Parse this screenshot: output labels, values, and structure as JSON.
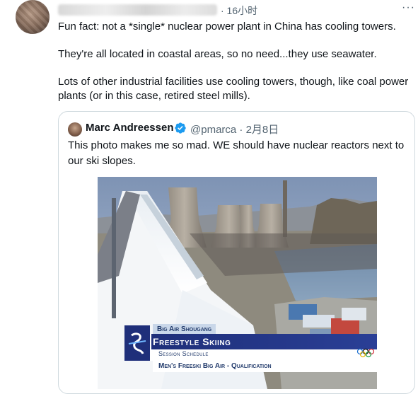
{
  "tweet": {
    "time": "· 16小时",
    "more_icon": "more-dots-icon",
    "paragraphs": [
      "Fun fact: not a *single* nuclear power plant in China has cooling towers.",
      "They're all located in coastal areas, so no need...they use seawater.",
      "Lots of other industrial facilities use cooling towers, though, like coal power plants (or in this case, retired steel mills)."
    ]
  },
  "quote": {
    "name": "Marc Andreessen",
    "handle": "@pmarca · 2月8日",
    "verified_icon": "verified-badge-icon",
    "text": "This photo makes me so mad. WE should have nuclear reactors next to our ski slopes.",
    "photo": {
      "banner_top": "Big Air Shougang",
      "banner_title": "Freestyle Skiing",
      "banner_sub": "Session Schedule",
      "banner_bottom": "Men's Freeski Big Air - Qualification"
    }
  },
  "colors": {
    "text": "#0f1419",
    "secondary": "#536471",
    "border": "#cfd9de",
    "verified": "#1d9bf0",
    "banner_blue": "#1f2f7a"
  }
}
